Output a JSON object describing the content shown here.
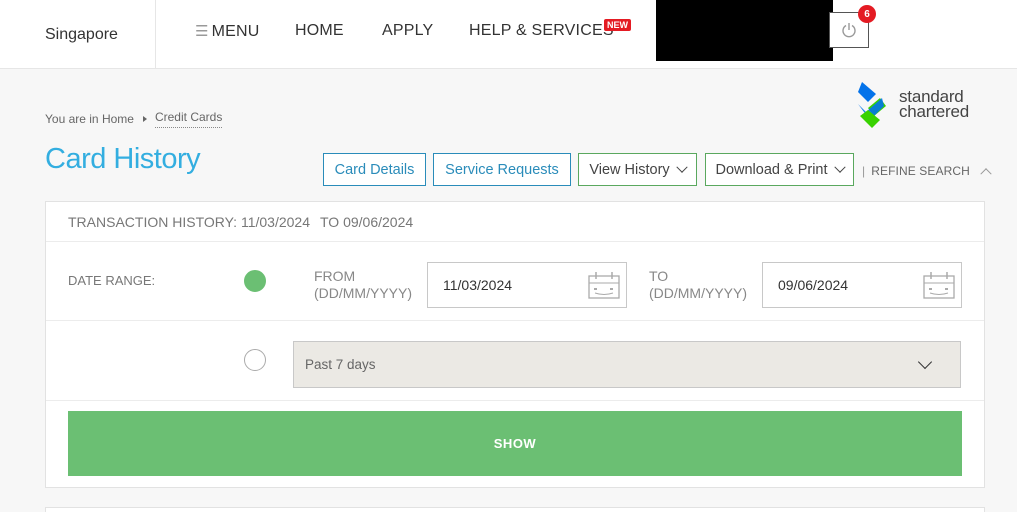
{
  "nav": {
    "country": "Singapore",
    "menu": "MENU",
    "menu_icon": "hamburger-icon",
    "home": "HOME",
    "apply": "APPLY",
    "help": "HELP & SERVICES",
    "new_badge": "NEW",
    "notification_count": "6",
    "power_icon": "power-icon"
  },
  "logo": {
    "line1": "standard",
    "line2": "chartered",
    "colors": [
      "#0473ea",
      "#38d200"
    ]
  },
  "breadcrumb": {
    "prefix": "You are in",
    "home": "Home",
    "current": "Credit Cards"
  },
  "page_title": "Card History",
  "actions": {
    "card_details": "Card Details",
    "service_requests": "Service Requests",
    "view_history": "View History",
    "download_print": "Download & Print",
    "refine_search": "REFINE SEARCH"
  },
  "history": {
    "label": "TRANSACTION HISTORY: 11/03/2024",
    "to": "TO 09/06/2024"
  },
  "date_range": {
    "label": "DATE RANGE:",
    "from_label": "FROM",
    "from_format": "(DD/MM/YYYY)",
    "from_value": "11/03/2024",
    "to_label": "TO",
    "to_format": "(DD/MM/YYYY)",
    "to_value": "09/06/2024",
    "preset_value": "Past 7 days"
  },
  "show_button": "SHOW",
  "colors": {
    "accent_blue": "#33aee0",
    "green": "#6bbf73",
    "badge_red": "#e41b23"
  }
}
